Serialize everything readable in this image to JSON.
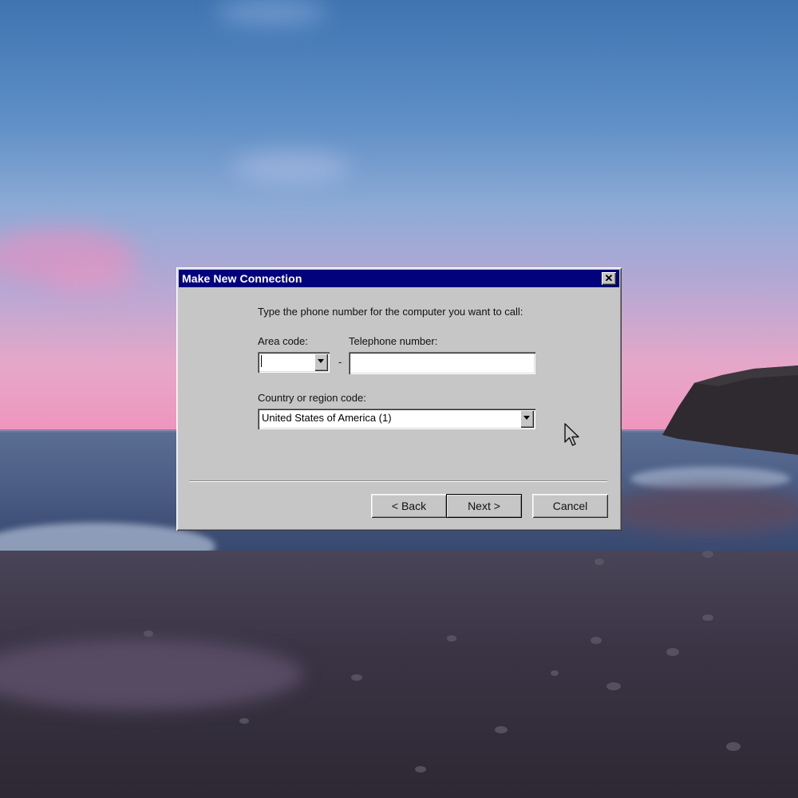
{
  "window": {
    "title": "Make New Connection"
  },
  "dialog": {
    "instruction": "Type the phone number for the computer you want to call:",
    "area_code": {
      "label": "Area code:",
      "value": ""
    },
    "separator_char": "-",
    "telephone_number": {
      "label": "Telephone number:",
      "value": ""
    },
    "country_code": {
      "label": "Country or region code:",
      "selected": "United States of America (1)"
    },
    "buttons": {
      "back": "< Back",
      "next": "Next >",
      "cancel": "Cancel"
    }
  },
  "icons": {
    "close": "close-icon",
    "dropdown": "chevron-down-icon",
    "pointer": "mouse-pointer-icon"
  },
  "colors": {
    "title_bar": "#02037c",
    "dialog_face": "#c6c6c6"
  }
}
